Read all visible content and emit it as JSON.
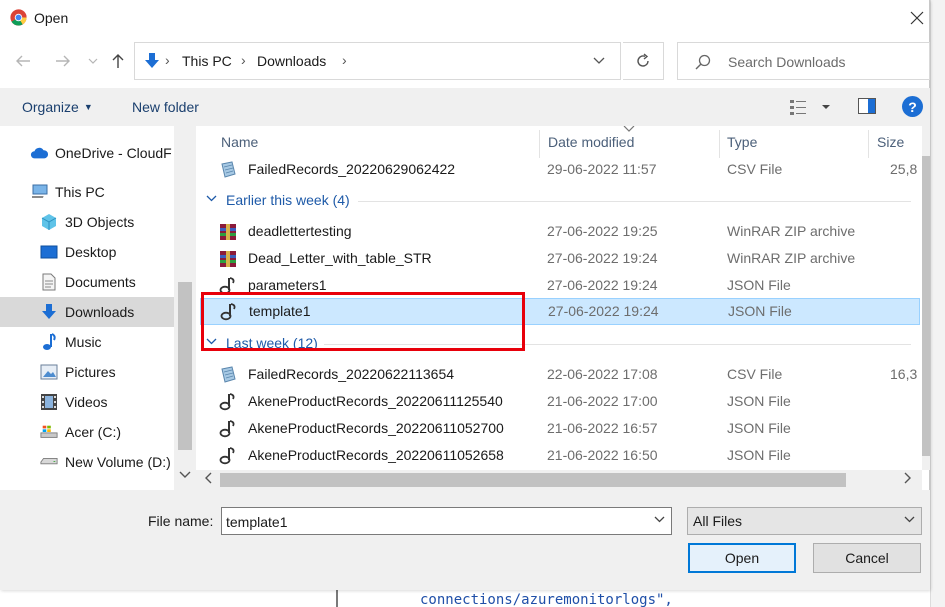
{
  "window": {
    "title": "Open"
  },
  "address": {
    "crumbs": [
      "This PC",
      "Downloads"
    ]
  },
  "search": {
    "placeholder": "Search Downloads"
  },
  "toolbar": {
    "organize": "Organize",
    "new_folder": "New folder",
    "help": "?"
  },
  "nav": {
    "items": [
      {
        "label": "OneDrive - CloudF",
        "icon": "cloud-icon"
      },
      {
        "label": "This PC",
        "icon": "computer-icon"
      },
      {
        "label": "3D Objects",
        "icon": "cube-icon"
      },
      {
        "label": "Desktop",
        "icon": "desktop-icon"
      },
      {
        "label": "Documents",
        "icon": "document-icon"
      },
      {
        "label": "Downloads",
        "icon": "download-arrow-icon",
        "selected": true
      },
      {
        "label": "Music",
        "icon": "music-note-icon"
      },
      {
        "label": "Pictures",
        "icon": "pictures-icon"
      },
      {
        "label": "Videos",
        "icon": "film-icon"
      },
      {
        "label": "Acer (C:)",
        "icon": "drive-icon"
      },
      {
        "label": "New Volume (D:)",
        "icon": "drive-icon"
      }
    ]
  },
  "columns": {
    "name": "Name",
    "date": "Date modified",
    "type": "Type",
    "size": "Size"
  },
  "files": {
    "top": {
      "name": "FailedRecords_20220629062422",
      "date": "29-06-2022 11:57",
      "type": "CSV File",
      "size": "25,8",
      "icon": "csv-icon"
    },
    "group1": {
      "label": "Earlier this week (4)",
      "rows": [
        {
          "name": "deadlettertesting",
          "date": "27-06-2022 19:25",
          "type": "WinRAR ZIP archive",
          "icon": "winrar-icon"
        },
        {
          "name": "Dead_Letter_with_table_STR",
          "date": "27-06-2022 19:24",
          "type": "WinRAR ZIP archive",
          "icon": "winrar-icon"
        },
        {
          "name": "parameters1",
          "date": "27-06-2022 19:24",
          "type": "JSON File",
          "icon": "json-icon"
        },
        {
          "name": "template1",
          "date": "27-06-2022 19:24",
          "type": "JSON File",
          "icon": "json-icon",
          "selected": true
        }
      ]
    },
    "group2": {
      "label": "Last week (12)",
      "rows": [
        {
          "name": "FailedRecords_20220622113654",
          "date": "22-06-2022 17:08",
          "type": "CSV File",
          "size": "16,3",
          "icon": "csv-icon"
        },
        {
          "name": "AkeneProductRecords_20220611125540",
          "date": "21-06-2022 17:00",
          "type": "JSON File",
          "icon": "json-icon"
        },
        {
          "name": "AkeneProductRecords_20220611052700",
          "date": "21-06-2022 16:57",
          "type": "JSON File",
          "icon": "json-icon"
        },
        {
          "name": "AkeneProductRecords_20220611052658",
          "date": "21-06-2022 16:50",
          "type": "JSON File",
          "icon": "json-icon"
        }
      ]
    }
  },
  "footer": {
    "file_name_label": "File name:",
    "file_name_value": "template1",
    "file_type": "All Files",
    "open": "Open",
    "cancel": "Cancel"
  },
  "background": {
    "code_line": "connections/azuremonitorlogs\","
  },
  "colors": {
    "accent": "#0078d7",
    "selection": "#cce8ff",
    "highlight_box": "#e8000b",
    "link": "#1e5aa8"
  }
}
